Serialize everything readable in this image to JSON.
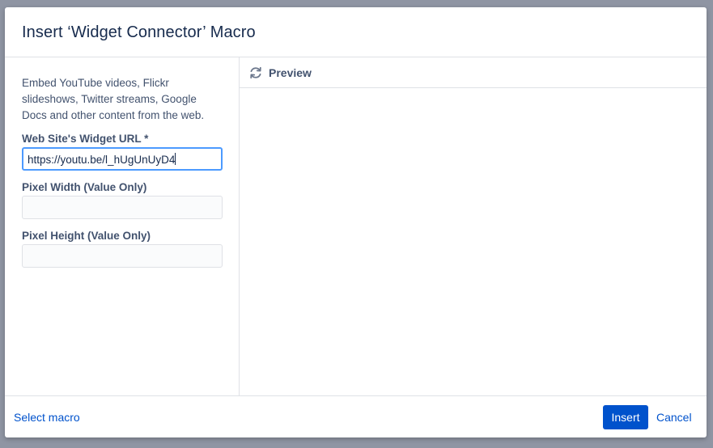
{
  "dialog": {
    "title": "Insert ‘Widget Connector’ Macro"
  },
  "form": {
    "description": "Embed YouTube videos, Flickr slideshows, Twitter streams, Google Docs and other content from the web.",
    "url_label": "Web Site's Widget URL *",
    "url_value": "https://youtu.be/l_hUgUnUyD4",
    "width_label": "Pixel Width (Value Only)",
    "width_value": "",
    "height_label": "Pixel Height (Value Only)",
    "height_value": ""
  },
  "preview": {
    "label": "Preview",
    "icon": "refresh-icon"
  },
  "footer": {
    "select_macro": "Select macro",
    "insert": "Insert",
    "cancel": "Cancel"
  },
  "colors": {
    "primary": "#0052cc",
    "focus": "#4c9aff",
    "backdrop": "#8f95a3"
  }
}
